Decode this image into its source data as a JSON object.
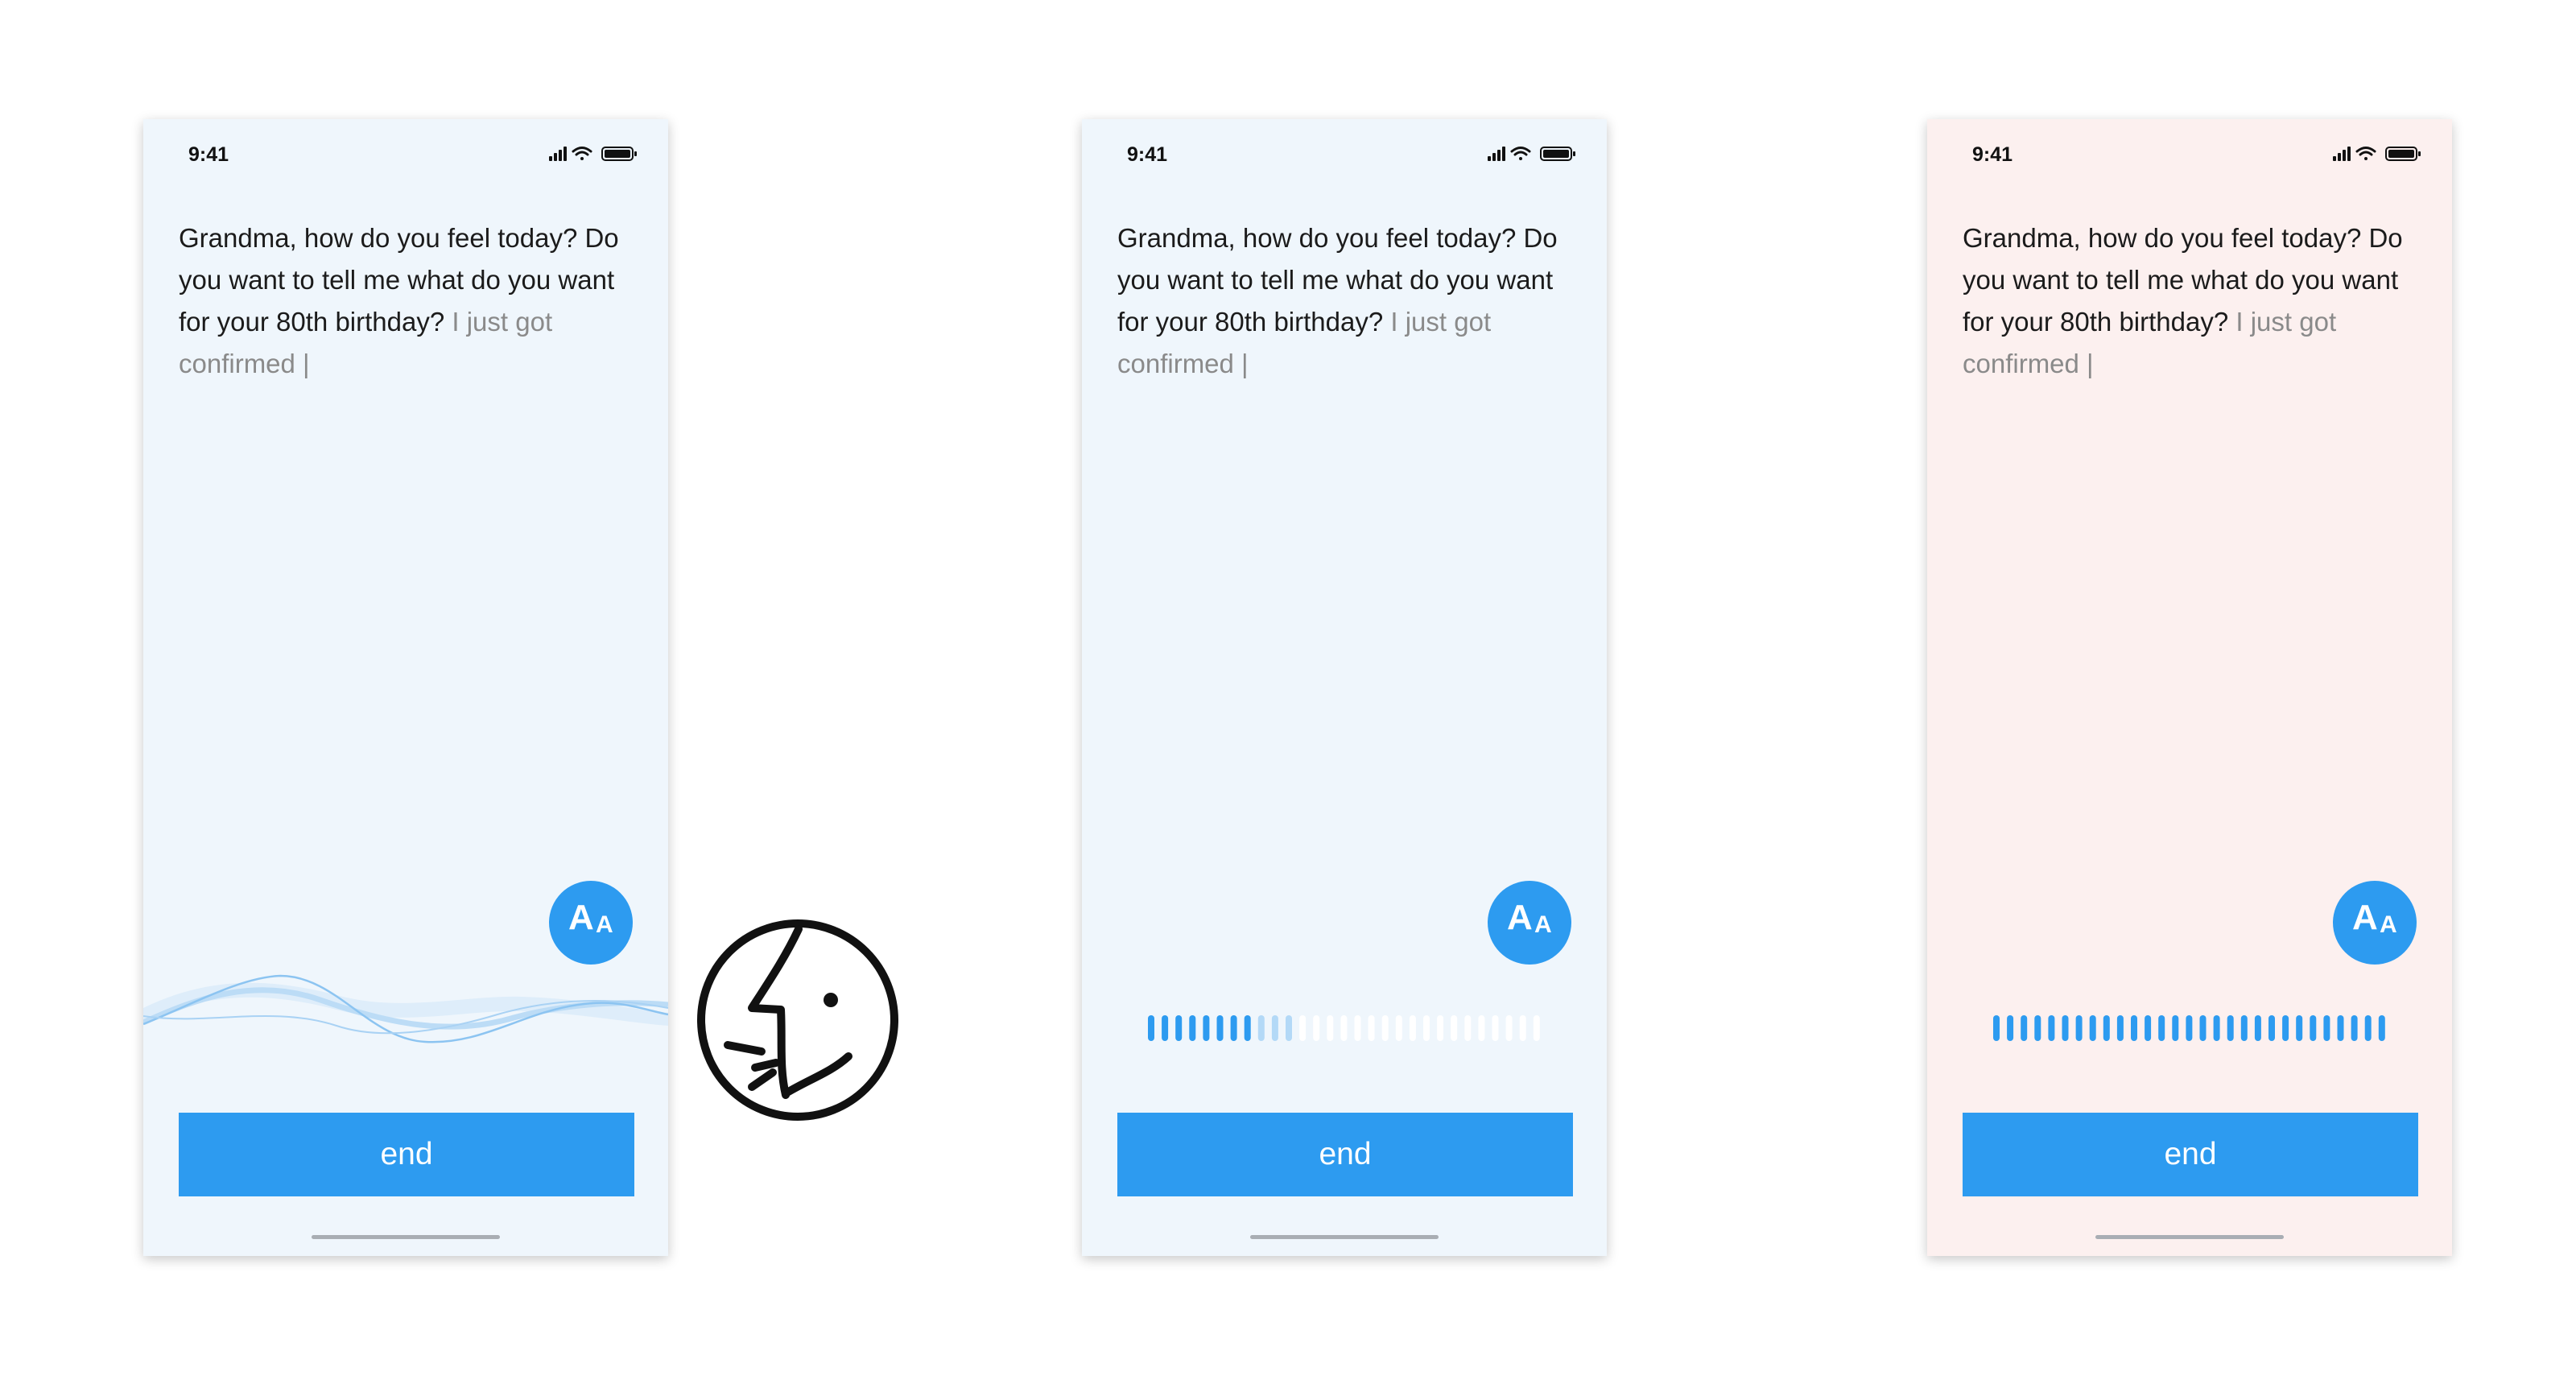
{
  "screens": [
    {
      "background": "#eff6fc",
      "indicator": "waveform",
      "status": {
        "time": "9:41"
      },
      "transcript": {
        "confirmed": "Grandma, how do you feel today? Do you want to tell me what do you want for your 80th birthday?",
        "pending": "I just got confirmed |"
      },
      "font_button": {
        "big": "A",
        "small": "A"
      },
      "end_label": "end"
    },
    {
      "background": "#eff6fc",
      "indicator": "level-meter",
      "meter": {
        "total": 29,
        "active": 8,
        "dim": 3,
        "level": 0.28
      },
      "status": {
        "time": "9:41"
      },
      "transcript": {
        "confirmed": "Grandma, how do you feel today? Do you want to tell me what do you want for your 80th birthday?",
        "pending": "I just got confirmed |"
      },
      "font_button": {
        "big": "A",
        "small": "A"
      },
      "end_label": "end"
    },
    {
      "background": "#fcf0ef",
      "indicator": "level-meter",
      "meter": {
        "total": 29,
        "active": 29,
        "dim": 0,
        "level": 1.0
      },
      "status": {
        "time": "9:41"
      },
      "transcript": {
        "confirmed": "Grandma, how do you feel today? Do you want to tell me what do you want for your 80th birthday?",
        "pending": "I just got confirmed |"
      },
      "font_button": {
        "big": "A",
        "small": "A"
      },
      "end_label": "end"
    }
  ],
  "accent_color": "#2d9bf0",
  "icons": {
    "signal": "cellular-signal-icon",
    "wifi": "wifi-icon",
    "battery": "battery-icon",
    "font_size": "font-size-icon",
    "speech": "speech-recognition-face-icon"
  }
}
